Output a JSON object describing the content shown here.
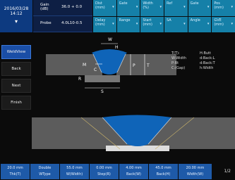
{
  "topbar": {
    "datetime_line1": "2016/03/28",
    "datetime_line2": "14:12",
    "gain_label": "Gain",
    "gain_sub": "(dB)",
    "gain_value": "36.0 + 0.0",
    "probe_label": "Probe",
    "probe_value": "4.0L10-0.5",
    "cells": [
      {
        "label": "Dist",
        "sub": "(mm)"
      },
      {
        "label": "Gate",
        "sub": ""
      },
      {
        "label": "Width",
        "sub": "(%)"
      },
      {
        "label": "Ref",
        "sub": ""
      },
      {
        "label": "Gate",
        "sub": ""
      },
      {
        "label": "Pos",
        "sub": "(mm)"
      },
      {
        "label": "Delay",
        "sub": "(mm)"
      },
      {
        "label": "Range",
        "sub": ""
      },
      {
        "label": "Start",
        "sub": "(mm)"
      },
      {
        "label": "SA",
        "sub": ""
      },
      {
        "label": "Angle",
        "sub": ""
      },
      {
        "label": "GVE",
        "sub": "(mm)"
      }
    ]
  },
  "sidebar": {
    "items": [
      "WeldView",
      "Back",
      "Next",
      "Finish"
    ]
  },
  "diagram": {
    "label_w": "W",
    "label_h": "H",
    "label_m": "M",
    "label_c": "C",
    "label_p": "P",
    "label_t": "T",
    "label_r": "R",
    "label_s": "S",
    "info_lines": [
      {
        "k": "T(T):",
        "v": "H:Butt"
      },
      {
        "k": "W:Width",
        "v": "d:Back:L"
      },
      {
        "k": "P:Rt",
        "v": "d:Back:T"
      },
      {
        "k": "C:(Gap)",
        "v": "h:Width"
      }
    ],
    "weld_color": "#0f64b8",
    "plate_color": "#5c5c5c"
  },
  "bottom": {
    "buttons": [
      {
        "value": "20.0 mm",
        "label": "Thk(T)"
      },
      {
        "value": "Double",
        "label": "WType"
      },
      {
        "value": "55.0 mm",
        "label": "W(Width)"
      },
      {
        "value": "0.00 mm",
        "label": "Step(R)"
      },
      {
        "value": "4.00 mm",
        "label": "Back(W)"
      },
      {
        "value": "45.0 mm",
        "label": "Back(H)"
      },
      {
        "value": "20.00 mm",
        "label": "Width(W)"
      }
    ],
    "page": "1/2"
  }
}
